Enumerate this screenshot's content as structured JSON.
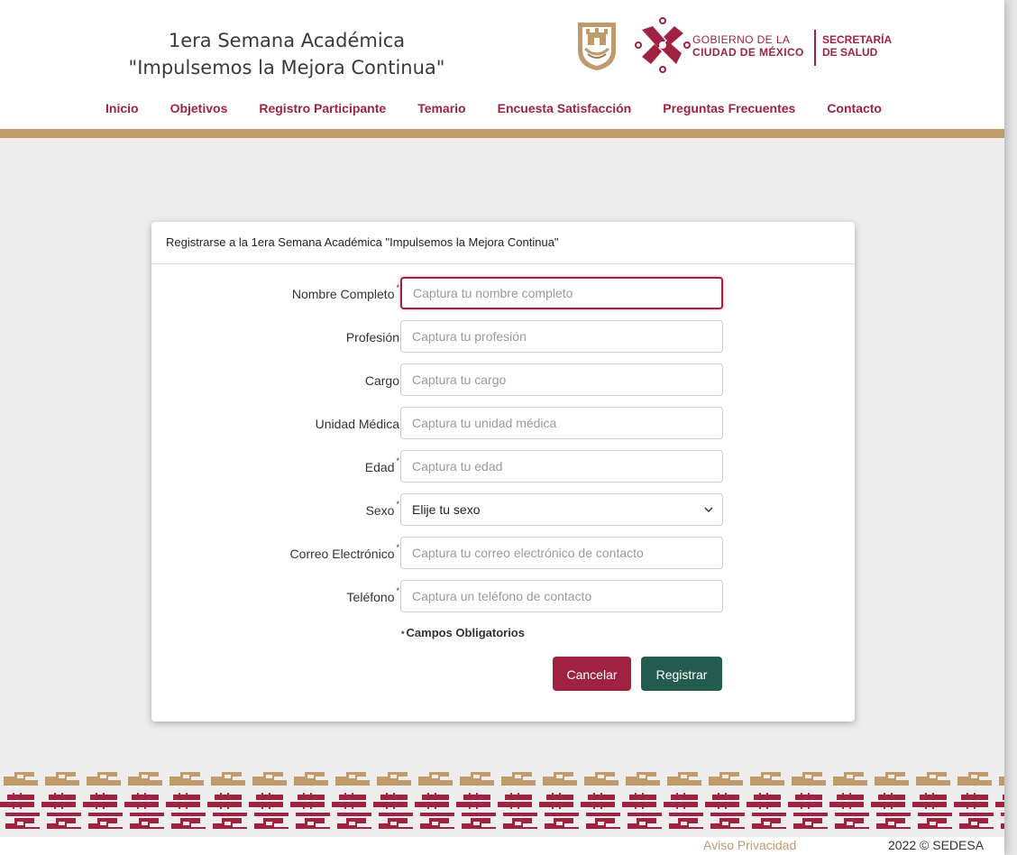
{
  "header": {
    "title_line1": "1era Semana Académica",
    "title_line2": "\"Impulsemos la Mejora Continua\"",
    "gov_line1": "GOBIERNO DE LA",
    "gov_line2": "CIUDAD DE MÉXICO",
    "sec_line1": "SECRETARÍA",
    "sec_line2": "DE SALUD",
    "accent_color": "#9f2241",
    "gold_color": "#c19a6b"
  },
  "nav": {
    "items": [
      {
        "label": "Inicio"
      },
      {
        "label": "Objetivos"
      },
      {
        "label": "Registro Participante"
      },
      {
        "label": "Temario"
      },
      {
        "label": "Encuesta Satisfacción"
      },
      {
        "label": "Preguntas Frecuentes"
      },
      {
        "label": "Contacto"
      }
    ]
  },
  "form": {
    "heading": "Registrarse a la 1era Semana Académica \"Impulsemos la Mejora Continua\"",
    "required_mark": "*",
    "fields": [
      {
        "label": "Nombre Completo",
        "placeholder": "Captura tu nombre completo",
        "required": true
      },
      {
        "label": "Profesión",
        "placeholder": "Captura tu profesión",
        "required": false
      },
      {
        "label": "Cargo",
        "placeholder": "Captura tu cargo",
        "required": false
      },
      {
        "label": "Unidad Médica",
        "placeholder": "Captura tu unidad médica",
        "required": false
      },
      {
        "label": "Edad",
        "placeholder": "Captura tu edad",
        "required": true
      },
      {
        "label": "Sexo",
        "selected": "Elije tu sexo",
        "required": true
      },
      {
        "label": "Correo Electrónico",
        "placeholder": "Captura tu correo electrónico de contacto",
        "required": true
      },
      {
        "label": "Teléfono",
        "placeholder": "Captura un teléfono de contacto",
        "required": true
      }
    ],
    "required_note": "Campos Obligatorios",
    "cancel_label": "Cancelar",
    "submit_label": "Registrar",
    "cancel_color": "#9f2241",
    "submit_color": "#235b4e"
  },
  "footer": {
    "privacy": "Aviso Privacidad",
    "copyright": "2022 © SEDESA"
  }
}
